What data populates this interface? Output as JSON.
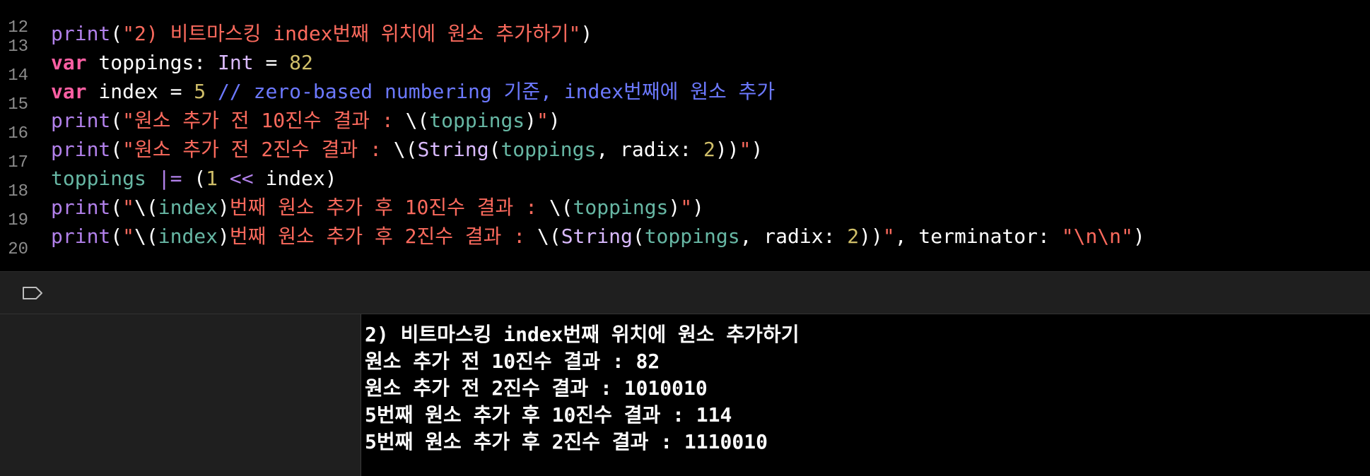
{
  "editor": {
    "line_numbers": [
      "12",
      "13",
      "14",
      "15",
      "16",
      "17",
      "18",
      "19",
      "20"
    ],
    "lines": [
      [],
      [
        {
          "t": "print",
          "c": "fn"
        },
        {
          "t": "(",
          "c": "pl"
        },
        {
          "t": "\"2) 비트마스킹 index번째 위치에 원소 추가하기\"",
          "c": "str"
        },
        {
          "t": ")",
          "c": "pl"
        }
      ],
      [
        {
          "t": "var",
          "c": "kw"
        },
        {
          "t": " toppings: ",
          "c": "pl"
        },
        {
          "t": "Int",
          "c": "ty"
        },
        {
          "t": " = ",
          "c": "pl"
        },
        {
          "t": "82",
          "c": "num"
        }
      ],
      [
        {
          "t": "var",
          "c": "kw"
        },
        {
          "t": " index = ",
          "c": "pl"
        },
        {
          "t": "5",
          "c": "num"
        },
        {
          "t": " // zero-based numbering 기준, index번째에 원소 추가",
          "c": "cmt"
        }
      ],
      [
        {
          "t": "print",
          "c": "fn"
        },
        {
          "t": "(",
          "c": "pl"
        },
        {
          "t": "\"원소 추가 전 10진수 결과 : ",
          "c": "str"
        },
        {
          "t": "\\(",
          "c": "pl"
        },
        {
          "t": "toppings",
          "c": "id"
        },
        {
          "t": ")",
          "c": "pl"
        },
        {
          "t": "\"",
          "c": "str"
        },
        {
          "t": ")",
          "c": "pl"
        }
      ],
      [
        {
          "t": "print",
          "c": "fn"
        },
        {
          "t": "(",
          "c": "pl"
        },
        {
          "t": "\"원소 추가 전 2진수 결과 : ",
          "c": "str"
        },
        {
          "t": "\\(",
          "c": "pl"
        },
        {
          "t": "String",
          "c": "ty"
        },
        {
          "t": "(",
          "c": "pl"
        },
        {
          "t": "toppings",
          "c": "id"
        },
        {
          "t": ", radix: ",
          "c": "pl"
        },
        {
          "t": "2",
          "c": "num"
        },
        {
          "t": "))",
          "c": "pl"
        },
        {
          "t": "\"",
          "c": "str"
        },
        {
          "t": ")",
          "c": "pl"
        }
      ],
      [
        {
          "t": "toppings",
          "c": "id"
        },
        {
          "t": " ",
          "c": "pl"
        },
        {
          "t": "|=",
          "c": "fn"
        },
        {
          "t": " (",
          "c": "pl"
        },
        {
          "t": "1",
          "c": "num"
        },
        {
          "t": " ",
          "c": "pl"
        },
        {
          "t": "<<",
          "c": "fn"
        },
        {
          "t": " index)",
          "c": "pl"
        }
      ],
      [
        {
          "t": "print",
          "c": "fn"
        },
        {
          "t": "(",
          "c": "pl"
        },
        {
          "t": "\"",
          "c": "str"
        },
        {
          "t": "\\(",
          "c": "pl"
        },
        {
          "t": "index",
          "c": "id"
        },
        {
          "t": ")",
          "c": "pl"
        },
        {
          "t": "번째 원소 추가 후 10진수 결과 : ",
          "c": "str"
        },
        {
          "t": "\\(",
          "c": "pl"
        },
        {
          "t": "toppings",
          "c": "id"
        },
        {
          "t": ")",
          "c": "pl"
        },
        {
          "t": "\"",
          "c": "str"
        },
        {
          "t": ")",
          "c": "pl"
        }
      ],
      [
        {
          "t": "print",
          "c": "fn"
        },
        {
          "t": "(",
          "c": "pl"
        },
        {
          "t": "\"",
          "c": "str"
        },
        {
          "t": "\\(",
          "c": "pl"
        },
        {
          "t": "index",
          "c": "id"
        },
        {
          "t": ")",
          "c": "pl"
        },
        {
          "t": "번째 원소 추가 후 2진수 결과 : ",
          "c": "str"
        },
        {
          "t": "\\(",
          "c": "pl"
        },
        {
          "t": "String",
          "c": "ty"
        },
        {
          "t": "(",
          "c": "pl"
        },
        {
          "t": "toppings",
          "c": "id"
        },
        {
          "t": ", radix: ",
          "c": "pl"
        },
        {
          "t": "2",
          "c": "num"
        },
        {
          "t": "))",
          "c": "pl"
        },
        {
          "t": "\"",
          "c": "str"
        },
        {
          "t": ", terminator: ",
          "c": "pl"
        },
        {
          "t": "\"\\n\\n\"",
          "c": "str"
        },
        {
          "t": ")",
          "c": "pl"
        }
      ]
    ]
  },
  "console_bar": {
    "icon": "tag-icon"
  },
  "console": {
    "output": [
      "2) 비트마스킹 index번째 위치에 원소 추가하기",
      "원소 추가 전 10진수 결과 : 82",
      "원소 추가 전 2진수 결과 : 1010010",
      "5번째 원소 추가 후 10진수 결과 : 114",
      "5번째 원소 추가 후 2진수 결과 : 1110010"
    ]
  },
  "colors": {
    "keyword": "#fc5fa3",
    "function": "#b281eb",
    "string": "#fc6a5d",
    "number": "#d0bf69",
    "comment": "#6c79ff",
    "type": "#dabaff",
    "identifier": "#67b7a4",
    "plain": "#ffffff",
    "background": "#000000"
  }
}
